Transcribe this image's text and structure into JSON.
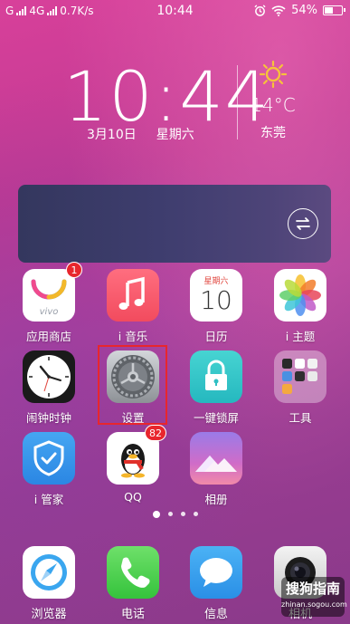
{
  "status_bar": {
    "left_text": "G",
    "network": "4G",
    "speed": "0.7K/s",
    "time": "10:44",
    "battery": "54%",
    "battery_level": 0.54
  },
  "clock": {
    "time": "10:44",
    "date": "3月10日",
    "weekday": "星期六",
    "temperature": "14°C",
    "city": "东莞"
  },
  "apps": [
    {
      "label": "应用商店",
      "icon": "vivo-appstore-icon",
      "badge": "1"
    },
    {
      "label": "i 音乐",
      "icon": "music-note-icon"
    },
    {
      "label": "日历",
      "icon": "calendar-icon",
      "cal_weekday": "星期六",
      "cal_day": "10"
    },
    {
      "label": "i 主题",
      "icon": "pinwheel-icon"
    },
    {
      "label": "闹钟时钟",
      "icon": "clock-icon"
    },
    {
      "label": "设置",
      "icon": "settings-gear-icon"
    },
    {
      "label": "一键锁屏",
      "icon": "lock-icon"
    },
    {
      "label": "工具",
      "icon": "folder-icon"
    },
    {
      "label": "i 管家",
      "icon": "shield-check-icon"
    },
    {
      "label": "QQ",
      "icon": "qq-penguin-icon",
      "badge": "82"
    },
    {
      "label": "相册",
      "icon": "mountain-photo-icon"
    }
  ],
  "page_indicator": {
    "pages": 4,
    "current": 1
  },
  "dock": [
    {
      "label": "浏览器",
      "icon": "compass-icon"
    },
    {
      "label": "电话",
      "icon": "phone-icon"
    },
    {
      "label": "信息",
      "icon": "message-bubble-icon"
    },
    {
      "label": "相机",
      "icon": "camera-icon"
    }
  ],
  "watermark": {
    "text": "搜狗指南",
    "sub": "zhinan.sogou.com"
  }
}
